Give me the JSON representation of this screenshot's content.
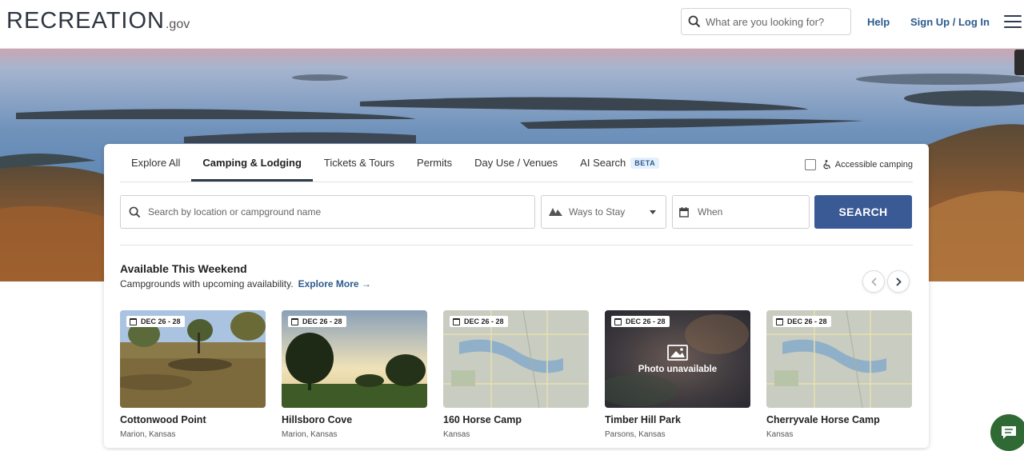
{
  "header": {
    "logo_main": "RECREATION",
    "logo_suffix": ".gov",
    "search_placeholder": "What are you looking for?",
    "help_label": "Help",
    "signup_label": "Sign Up / Log In"
  },
  "tabs": [
    {
      "label": "Explore All",
      "active": false
    },
    {
      "label": "Camping & Lodging",
      "active": true
    },
    {
      "label": "Tickets & Tours",
      "active": false
    },
    {
      "label": "Permits",
      "active": false
    },
    {
      "label": "Day Use / Venues",
      "active": false
    },
    {
      "label": "AI Search",
      "active": false
    }
  ],
  "beta_badge": "BETA",
  "accessible_label": "Accessible camping",
  "search_form": {
    "location_placeholder": "Search by location or campground name",
    "ways_to_stay": "Ways to Stay",
    "when": "When",
    "search_button": "SEARCH"
  },
  "available": {
    "title": "Available This Weekend",
    "subtitle": "Campgrounds with upcoming availability.",
    "explore_more": "Explore More →"
  },
  "campgrounds": [
    {
      "date": "DEC 26 - 28",
      "name": "Cottonwood Point",
      "location": "Marion, Kansas",
      "image": "park-field"
    },
    {
      "date": "DEC 26 - 28",
      "name": "Hillsboro Cove",
      "location": "Marion, Kansas",
      "image": "sunset-trees"
    },
    {
      "date": "DEC 26 - 28",
      "name": "160 Horse Camp",
      "location": "Kansas",
      "image": "map"
    },
    {
      "date": "DEC 26 - 28",
      "name": "Timber Hill Park",
      "location": "Parsons, Kansas",
      "image": "unavailable",
      "unavailable_text": "Photo unavailable"
    },
    {
      "date": "DEC 26 - 28",
      "name": "Cherryvale Horse Camp",
      "location": "Kansas",
      "image": "map"
    }
  ],
  "colors": {
    "primary": "#3a5a96",
    "link": "#2c5a8c",
    "chat": "#2f6a34"
  }
}
